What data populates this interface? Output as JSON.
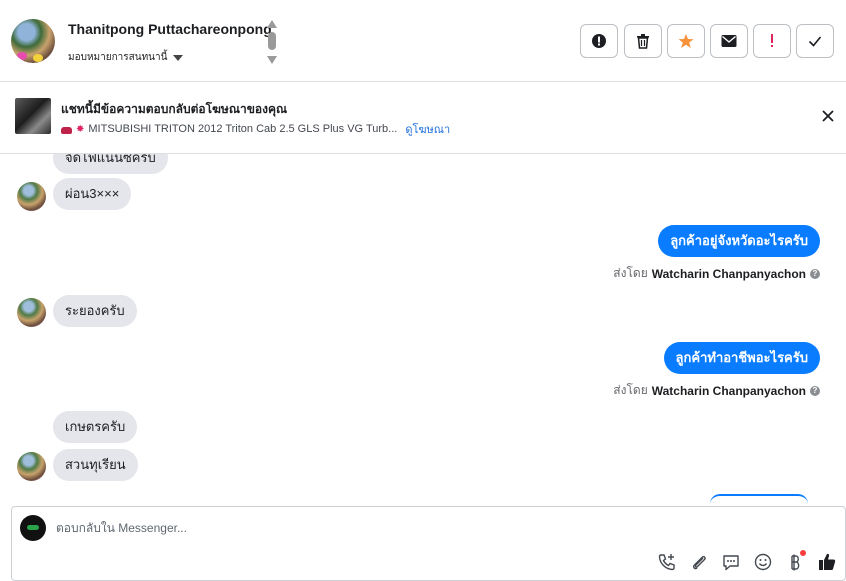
{
  "header": {
    "contact_name": "Thanitpong Puttachareonpong",
    "assign_label": "มอบหมายการสนทนานี้",
    "actions": [
      {
        "name": "report-spam-icon",
        "color": "#1c1e21"
      },
      {
        "name": "trash-icon",
        "color": "#1c1e21"
      },
      {
        "name": "star-icon",
        "color": "#f7923a"
      },
      {
        "name": "mail-icon",
        "color": "#1c1e21"
      },
      {
        "name": "exclamation-icon",
        "color": "#e0245e"
      },
      {
        "name": "checkmark-icon",
        "color": "#1c1e21"
      }
    ]
  },
  "ad": {
    "title": "แชทนี้มีข้อความตอบกลับต่อโฆษณาของคุณ",
    "description": "MITSUBISHI TRITON 2012 Triton Cab 2.5 GLS Plus VG Turb...",
    "link": "ดูโฆษณา"
  },
  "messages": [
    {
      "dir": "in",
      "text": "จัดไฟแนนซ์ครับ"
    },
    {
      "dir": "in",
      "text": "ผ่อน3×××"
    },
    {
      "dir": "out",
      "text": "ลูกค้าอยู่จังหวัดอะไรครับ",
      "sent_prefix": "ส่งโดย",
      "sender": "Watcharin Chanpanyachon"
    },
    {
      "dir": "in",
      "text": "ระยองครับ"
    },
    {
      "dir": "out",
      "text": "ลูกค้าทำอาชีพอะไรครับ",
      "sent_prefix": "ส่งโดย",
      "sender": "Watcharin Chanpanyachon"
    },
    {
      "dir": "in",
      "text": "เกษตรครับ"
    },
    {
      "dir": "in",
      "text": "สวนทุเรียน"
    }
  ],
  "composer": {
    "placeholder": "ตอบกลับใน Messenger...",
    "tools": [
      "phone-plus-icon",
      "paperclip-icon",
      "saved-replies-icon",
      "emoji-icon",
      "baht-payment-icon",
      "thumbs-up-icon"
    ]
  },
  "colors": {
    "accent": "#0a7cff",
    "incoming_bubble": "#e4e6eb",
    "link": "#216fdb",
    "star": "#f7923a"
  }
}
